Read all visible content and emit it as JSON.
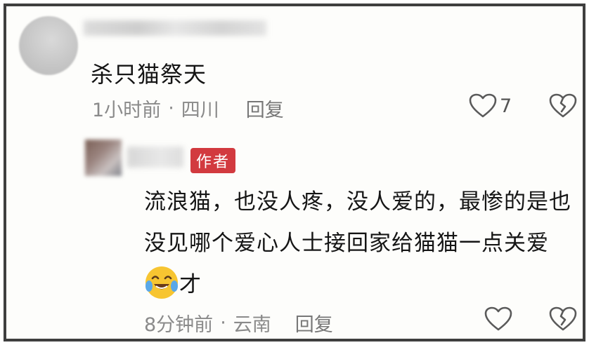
{
  "comment": {
    "text": "杀只猫祭天",
    "time": "1小时前",
    "location": "四川",
    "reply_label": "回复",
    "like_count": "7"
  },
  "reply": {
    "badge": "作者",
    "text_before_emoji": "流浪猫，也没人疼，没人爱的，最惨的是也没见哪个爱心人士接回家给猫猫一点关爱",
    "emoji_name": "crying-laughing-face",
    "text_after_emoji": "才",
    "time": "8分钟前",
    "location": "云南",
    "reply_label": "回复"
  },
  "separator": "·",
  "icons": {
    "like": "heart-outline-icon",
    "dislike": "broken-heart-outline-icon"
  }
}
